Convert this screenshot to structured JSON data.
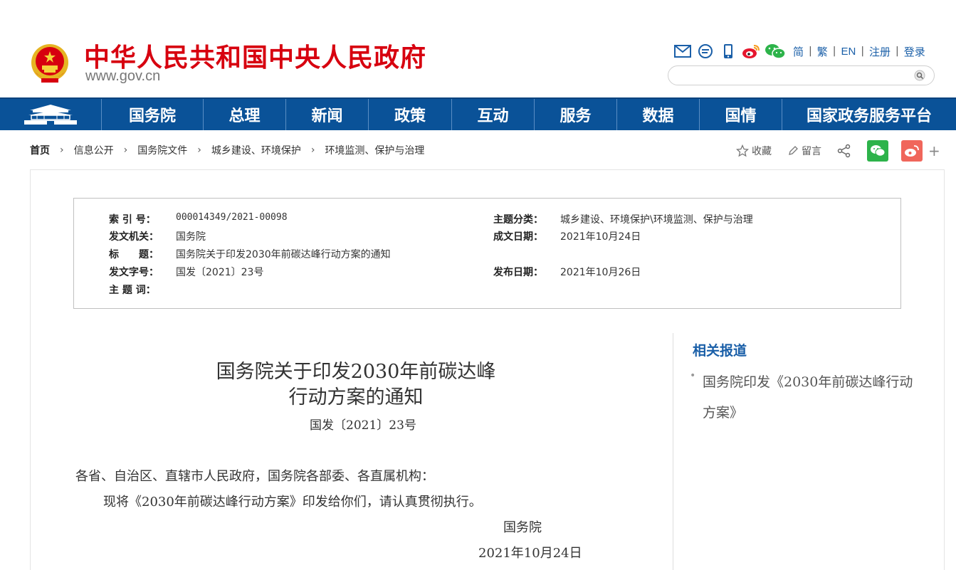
{
  "header": {
    "site_title": "中华人民共和国中央人民政府",
    "site_domain": "www.gov.cn",
    "tools": {
      "icons": [
        "mail-icon",
        "chat-icon",
        "mobile-icon",
        "weibo-icon",
        "wechat-icon"
      ],
      "langs": [
        "简",
        "繁",
        "EN",
        "注册",
        "登录"
      ]
    },
    "search_placeholder": ""
  },
  "nav": {
    "items": [
      "国务院",
      "总理",
      "新闻",
      "政策",
      "互动",
      "服务",
      "数据",
      "国情",
      "国家政务服务平台"
    ]
  },
  "breadcrumb": {
    "home": "首页",
    "items": [
      "信息公开",
      "国务院文件",
      "城乡建设、环境保护",
      "环境监测、保护与治理"
    ]
  },
  "share": {
    "favorite": "收藏",
    "comment": "留言",
    "more": "+"
  },
  "meta": {
    "index_label": "索 引 号：",
    "index_value": "000014349/2021-00098",
    "issuer_label": "发文机关：",
    "issuer_value": "国务院",
    "title_label": "标　　题：",
    "title_value": "国务院关于印发2030年前碳达峰行动方案的通知",
    "docno_label": "发文字号：",
    "docno_value": "国发〔2021〕23号",
    "keywords_label": "主 题 词：",
    "keywords_value": "",
    "category_label": "主题分类：",
    "category_value": "城乡建设、环境保护\\环境监测、保护与治理",
    "created_label": "成文日期：",
    "created_value": "2021年10月24日",
    "published_label": "发布日期：",
    "published_value": "2021年10月26日"
  },
  "article": {
    "title_line1": "国务院关于印发2030年前碳达峰",
    "title_line2": "行动方案的通知",
    "docno": "国发〔2021〕23号",
    "salutation": "各省、自治区、直辖市人民政府，国务院各部委、各直属机构：",
    "body": "现将《2030年前碳达峰行动方案》印发给你们，请认真贯彻执行。",
    "signature": "国务院",
    "date": "2021年10月24日"
  },
  "sidebar": {
    "title": "相关报道",
    "items": [
      "国务院印发《2030年前碳达峰行动方案》"
    ]
  },
  "colors": {
    "brand_red": "#d7000f",
    "nav_blue": "#0a5298",
    "link_blue": "#1a5fa8",
    "wechat_green": "#2db34a",
    "weibo_red": "#f0665b"
  }
}
